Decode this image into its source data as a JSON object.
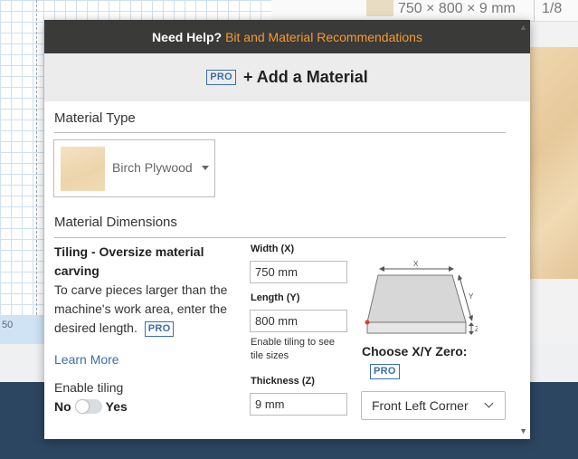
{
  "background": {
    "top_material_size": "750 × 800 × 9 mm",
    "top_right_fraction": "1/8",
    "ruler_label": "50"
  },
  "modal": {
    "help": {
      "prefix": "Need Help?",
      "link": "Bit and Material Recommendations"
    },
    "add_material": {
      "badge": "PRO",
      "label": "+ Add a Material"
    },
    "material_type": {
      "heading": "Material Type",
      "selected": "Birch Plywood"
    },
    "dimensions": {
      "heading": "Material Dimensions",
      "tiling": {
        "title": "Tiling - Oversize material carving",
        "description": "To carve pieces larger than the machine's work area, enter the desired length.",
        "badge": "PRO",
        "learn_more": "Learn More",
        "enable_label": "Enable tiling",
        "off_label": "No",
        "on_label": "Yes",
        "enabled": false
      },
      "width": {
        "label": "Width (X)",
        "value": "750 mm"
      },
      "length": {
        "label": "Length (Y)",
        "value": "800 mm",
        "hint": "Enable tiling to see tile sizes"
      },
      "thickness": {
        "label": "Thickness (Z)",
        "value": "9 mm"
      },
      "diagram": {
        "x": "X",
        "y": "Y",
        "z": "Z"
      },
      "zero": {
        "label": "Choose X/Y Zero:",
        "badge": "PRO",
        "selected": "Front Left Corner"
      }
    }
  },
  "colors": {
    "help_link": "#f59a2e",
    "pro_badge": "#3b6ea8",
    "help_bar_bg": "#3a3a38",
    "footer_bg": "#2c4560"
  }
}
